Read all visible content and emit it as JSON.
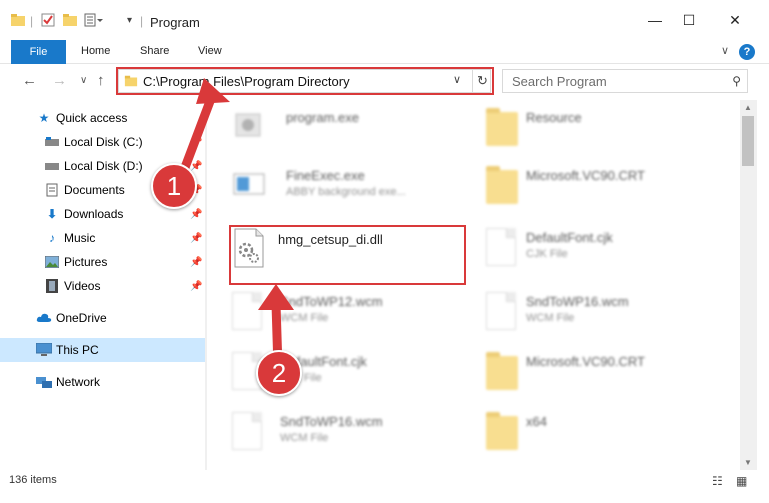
{
  "window": {
    "title": "Program",
    "minimize": "—",
    "maximize": "☐",
    "close": "✕"
  },
  "ribbon": {
    "file": "File",
    "home": "Home",
    "share": "Share",
    "view": "View",
    "help": "?"
  },
  "nav": {
    "address": "C:\\Program Files\\Program Directory",
    "search_placeholder": "Search Program"
  },
  "sidebar": {
    "items": [
      {
        "label": "Quick access"
      },
      {
        "label": "Local Disk (C:)"
      },
      {
        "label": "Local Disk (D:)"
      },
      {
        "label": "Documents"
      },
      {
        "label": "Downloads"
      },
      {
        "label": "Music"
      },
      {
        "label": "Pictures"
      },
      {
        "label": "Videos"
      },
      {
        "label": "OneDrive"
      },
      {
        "label": "This PC"
      },
      {
        "label": "Network"
      }
    ]
  },
  "files": {
    "program_exe": {
      "name": "program.exe"
    },
    "resource": {
      "name": "Resource"
    },
    "fineexec": {
      "name": "FineExec.exe",
      "type": "ABBY background exe..."
    },
    "msvc90_1": {
      "name": "Microsoft.VC90.CRT"
    },
    "target": {
      "name": "hmg_cetsup_di.dll"
    },
    "defaultfont_right": {
      "name": "DefaultFont.cjk",
      "type": "CJK File"
    },
    "sndtowp12": {
      "name": "SndToWP12.wcm",
      "type": "WCM File"
    },
    "sndtowp16_right": {
      "name": "SndToWP16.wcm",
      "type": "WCM File"
    },
    "defaultfont_left": {
      "name": "DefaultFont.cjk",
      "type": "CJK File"
    },
    "msvc90_2": {
      "name": "Microsoft.VC90.CRT"
    },
    "sndtowp16_left": {
      "name": "SndToWP16.wcm",
      "type": "WCM File"
    },
    "x64": {
      "name": "x64"
    }
  },
  "status": {
    "count": "136 items"
  },
  "annotations": {
    "step1": "1",
    "step2": "2"
  },
  "colors": {
    "accent": "#1979ca",
    "highlight": "#d9393a",
    "selection": "#cce8ff"
  }
}
